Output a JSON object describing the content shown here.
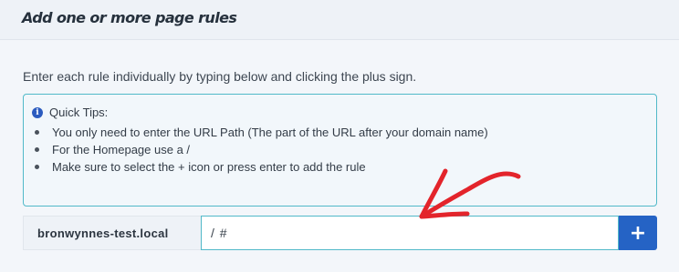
{
  "header": {
    "title": "Add one or more page rules"
  },
  "intro": "Enter each rule individually by typing below and clicking the plus sign.",
  "tips": {
    "heading": "Quick Tips:",
    "items": [
      "You only need to enter the URL Path (The part of the URL after your domain name)",
      "For the Homepage use a /",
      "Make sure to select the + icon or press enter to add the rule"
    ]
  },
  "rule_input": {
    "domain": "bronwynnes-test.local",
    "value": "/ #",
    "add_label": "+"
  },
  "colors": {
    "accent": "#2563c5",
    "border_teal": "#51b9c9",
    "arrow_red": "#e3242b"
  }
}
